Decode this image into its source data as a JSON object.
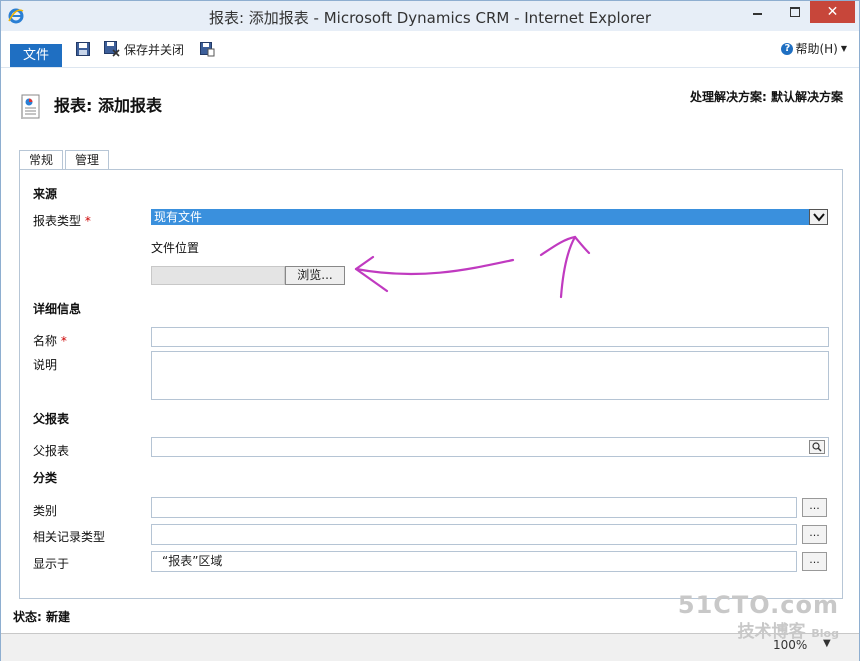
{
  "window": {
    "title": "报表: 添加报表 - Microsoft Dynamics CRM - Internet Explorer",
    "close": "✕"
  },
  "ribbon": {
    "file_tab": "文件",
    "save_close_label": "保存并关闭",
    "help_label": "帮助(H)"
  },
  "header": {
    "title": "报表: 添加报表",
    "solution": "处理解决方案: 默认解决方案"
  },
  "tabs": [
    "常规",
    "管理"
  ],
  "sections": {
    "source": {
      "title": "来源",
      "report_type_label": "报表类型",
      "report_type_value": "现有文件",
      "file_location_label": "文件位置",
      "browse_label": "浏览..."
    },
    "details": {
      "title": "详细信息",
      "name_label": "名称",
      "description_label": "说明"
    },
    "parent": {
      "title": "父报表",
      "parent_label": "父报表"
    },
    "category": {
      "title": "分类",
      "category_label": "类别",
      "related_label": "相关记录类型",
      "display_label": "显示于",
      "display_value": "“报表”区域",
      "ellipsis": "..."
    }
  },
  "required_mark": "*",
  "status": "状态: 新建",
  "statusbar": {
    "zoom": "100%"
  },
  "watermark": {
    "line1": "51CTO.com",
    "line2": "技术博客",
    "line3": "Blog"
  },
  "colors": {
    "accent": "#1f6fc2",
    "select_highlight": "#3a90dd",
    "annotation": "#c03ac0"
  }
}
